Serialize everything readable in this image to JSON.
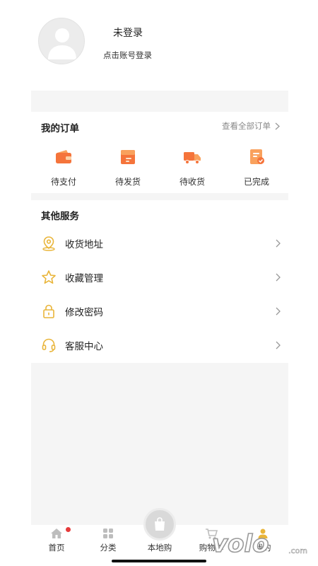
{
  "profile": {
    "title": "未登录",
    "subtitle": "点击账号登录"
  },
  "orders": {
    "title": "我的订单",
    "view_all": "查看全部订单",
    "items": [
      {
        "label": "待支付",
        "icon": "wallet-icon"
      },
      {
        "label": "待发货",
        "icon": "package-icon"
      },
      {
        "label": "待收货",
        "icon": "delivery-truck-icon"
      },
      {
        "label": "已完成",
        "icon": "completed-order-icon"
      }
    ]
  },
  "services": {
    "title": "其他服务",
    "items": [
      {
        "label": "收货地址",
        "icon": "location-pin-icon"
      },
      {
        "label": "收藏管理",
        "icon": "star-icon"
      },
      {
        "label": "修改密码",
        "icon": "lock-icon"
      },
      {
        "label": "客服中心",
        "icon": "headset-icon"
      }
    ]
  },
  "tabbar": {
    "items": [
      {
        "label": "首页",
        "icon": "home-icon",
        "badge": true
      },
      {
        "label": "分类",
        "icon": "grid-icon"
      },
      {
        "label": "本地购",
        "icon": "shopping-bag-icon"
      },
      {
        "label": "购物车",
        "icon": "cart-icon"
      },
      {
        "label": "我的",
        "icon": "user-icon"
      }
    ]
  },
  "colors": {
    "accent_orange": "#f5743b",
    "service_icon_yellow": "#e9b53a",
    "badge_red": "#e63b3b",
    "background_gray": "#f5f5f5"
  }
}
